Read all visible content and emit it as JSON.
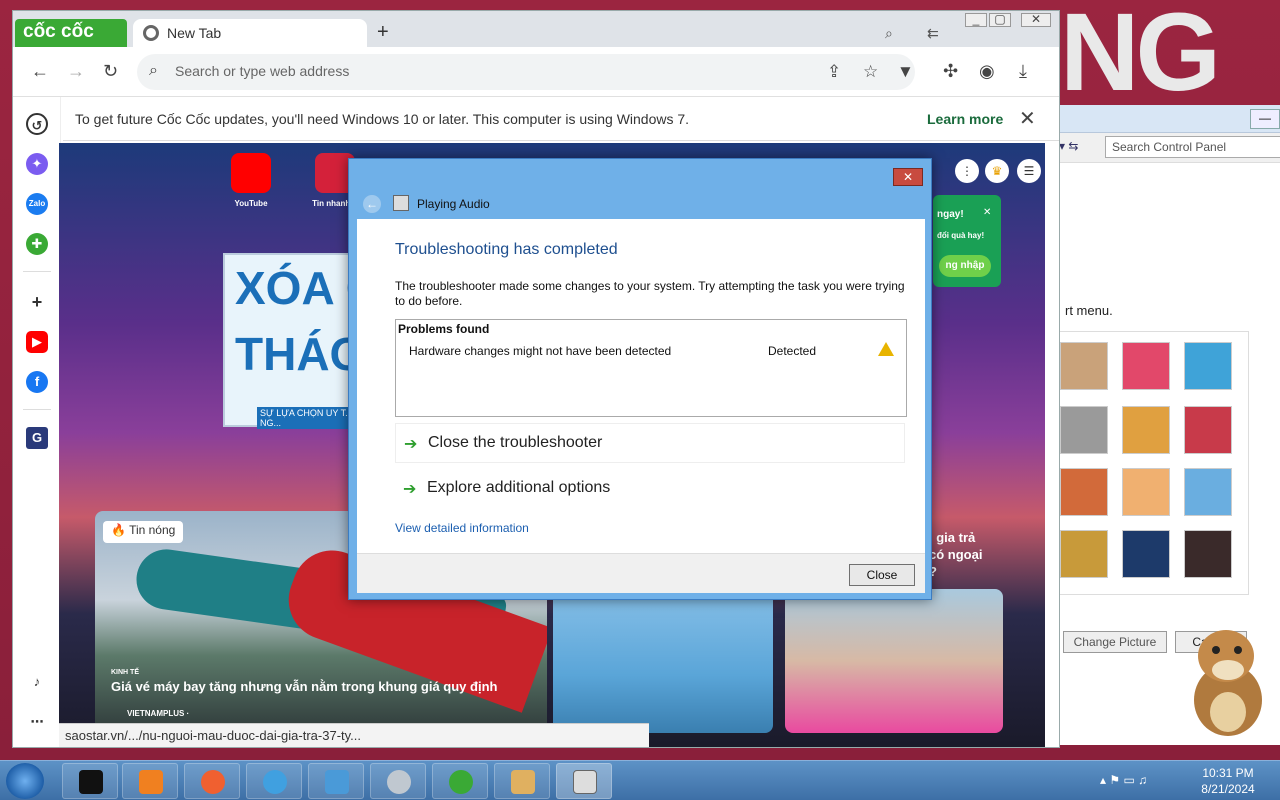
{
  "desktop": {
    "letters": "NG"
  },
  "browser": {
    "logo": "cốc cốc",
    "tab_title": "New Tab",
    "new_tab": "+",
    "address_placeholder": "Search or type web address",
    "infobar_text": "To get future Cốc Cốc updates, you'll need Windows 10 or later. This computer is using Windows 7.",
    "infobar_learn": "Learn more",
    "shortcuts": [
      {
        "label": "YouTube",
        "color": "#ff0000"
      },
      {
        "label": "Tin nhanh V",
        "color": "#d4213a"
      }
    ],
    "banner_line1": "XÓA C",
    "banner_line2": "THÁO K",
    "banner_sub": "SỰ LỰA CHỌN UY T... CỦA RẤT NHIỀU NG...",
    "promo_text": "ngay!",
    "promo_sub": "đổi quà hay!",
    "promo_btn": "ng nhập",
    "hot_label": "Tin nóng",
    "news_category": "KINH TẾ",
    "news_title": "Giá vé máy bay tăng nhưng vẫn nằm trong khung giá quy định",
    "news_source": "VIETNAMPLUS ·",
    "card3_text": "i gia trả\ncó ngoại\n?",
    "status_url": "saostar.vn/.../nu-nguoi-mau-duoc-dai-gia-tra-37-ty..."
  },
  "dialog": {
    "title": "Playing Audio",
    "heading": "Troubleshooting has completed",
    "message": "The troubleshooter made some changes to your system. Try attempting the task you were trying to do before.",
    "problems_header": "Problems found",
    "problem_item": "Hardware changes might not have been detected",
    "problem_status": "Detected",
    "option_close": "Close the troubleshooter",
    "option_explore": "Explore additional options",
    "detail_link": "View detailed information",
    "close_button": "Close",
    "close_x": "✕"
  },
  "control_panel": {
    "search_placeholder": "Search Control Panel",
    "text": "rt menu.",
    "change_picture": "Change Picture",
    "cancel": "Cancel"
  },
  "taskbar": {
    "time": "10:31 PM",
    "date": "8/21/2024"
  },
  "colors": {
    "accent_green": "#3aa935",
    "dialog_blue": "#6fb0e8",
    "link_blue": "#1c5fb0"
  }
}
